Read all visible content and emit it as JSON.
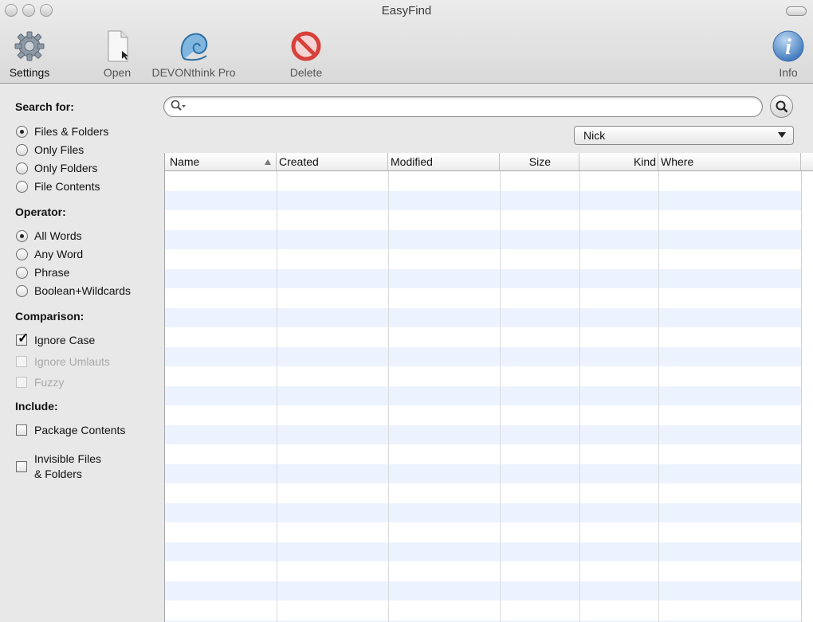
{
  "window": {
    "title": "EasyFind"
  },
  "toolbar": {
    "settings": "Settings",
    "open": "Open",
    "devonthink": "DEVONthink Pro",
    "delete": "Delete",
    "info": "Info"
  },
  "sidebar": {
    "search_for": {
      "heading": "Search for:",
      "options": [
        "Files & Folders",
        "Only Files",
        "Only Folders",
        "File Contents"
      ],
      "selected": "Files & Folders"
    },
    "operator": {
      "heading": "Operator:",
      "options": [
        "All Words",
        "Any Word",
        "Phrase",
        "Boolean+Wildcards"
      ],
      "selected": "All Words"
    },
    "comparison": {
      "heading": "Comparison:",
      "ignore_case": "Ignore Case",
      "ignore_umlauts": "Ignore Umlauts",
      "fuzzy": "Fuzzy"
    },
    "include": {
      "heading": "Include:",
      "package_contents": "Package Contents",
      "invisible_line1": "Invisible Files",
      "invisible_line2": "& Folders"
    }
  },
  "search": {
    "value": ""
  },
  "location": {
    "selected": "Nick"
  },
  "table": {
    "columns": [
      "Name",
      "Created",
      "Modified",
      "Size",
      "Kind",
      "Where"
    ],
    "sort_column": "Name",
    "rows": []
  },
  "colors": {
    "row_stripe": "#edf3fe",
    "delete_red": "#d8403a",
    "info_blue": "#4a86c8"
  }
}
